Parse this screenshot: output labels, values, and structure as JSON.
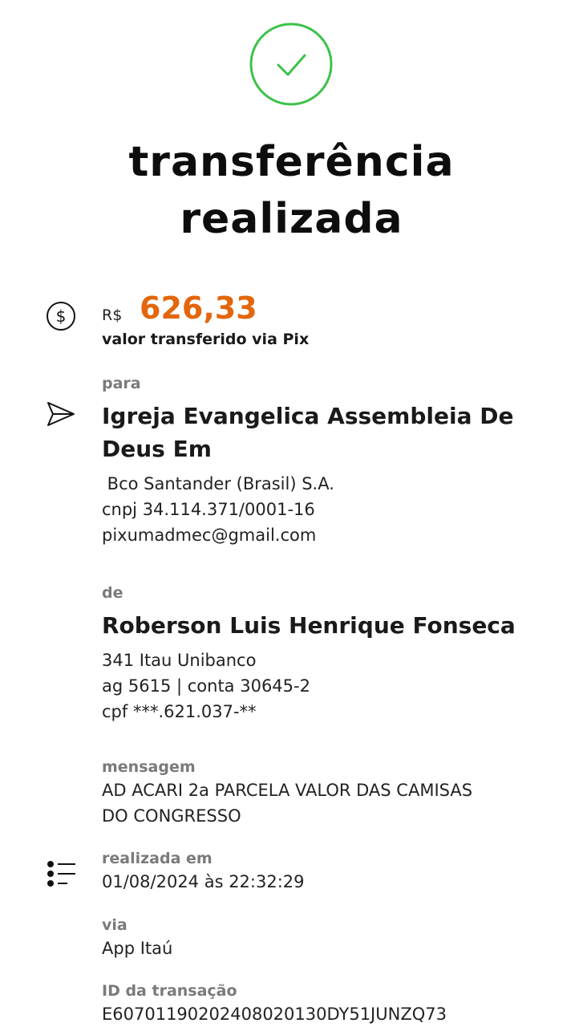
{
  "header": {
    "title_line1": "transferência",
    "title_line2": "realizada"
  },
  "amount": {
    "currency": "R$",
    "value": "626,33",
    "description": "valor transferido via Pix",
    "color": "#e3660c"
  },
  "recipient": {
    "label": "para",
    "name_line1": "Igreja Evangelica Assembleia De",
    "name_line2": "Deus Em",
    "bank": " Bco Santander (Brasil) S.A.",
    "document": "cnpj 34.114.371/0001-16",
    "pix_key": "pixumadmec@gmail.com"
  },
  "sender": {
    "label": "de",
    "name": "Roberson Luis Henrique Fonseca",
    "bank": "341 Itau Unibanco",
    "account": "ag 5615 | conta 30645-2",
    "document": "cpf ***.621.037-**"
  },
  "message": {
    "label": "mensagem",
    "line1": "AD ACARI 2a PARCELA VALOR DAS CAMISAS",
    "line2": "DO CONGRESSO"
  },
  "details": {
    "date_label": "realizada em",
    "date_value": "01/08/2024 às 22:32:29",
    "via_label": "via",
    "via_value": "App Itaú",
    "id_label": "ID da transação",
    "id_value": "E60701190202408020130DY51JUNZQ73"
  },
  "icons": {
    "success": "check-circle-icon",
    "amount": "dollar-circle-icon",
    "recipient": "send-icon",
    "details": "list-icon"
  },
  "colors": {
    "success_green": "#3cc24a",
    "accent_orange": "#e3660c"
  }
}
